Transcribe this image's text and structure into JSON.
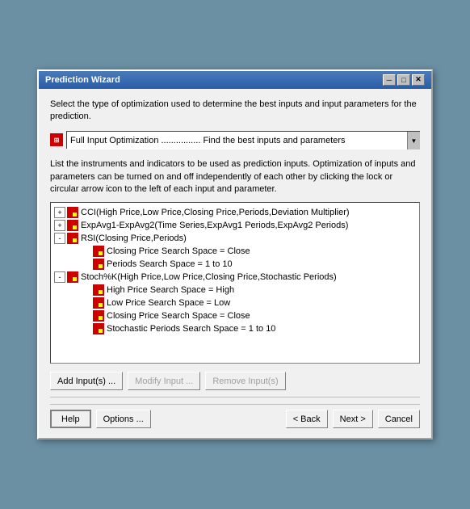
{
  "window": {
    "title": "Prediction Wizard",
    "close_btn": "✕",
    "minimize_btn": "─",
    "maximize_btn": "□"
  },
  "header": {
    "instruction1": "Select the type of optimization used to determine the best inputs and input parameters for the prediction.",
    "dropdown": {
      "icon": "⊞",
      "value": "Full Input Optimization ................ Find the best inputs and parameters"
    },
    "instruction2": "List the instruments and indicators to be used as prediction inputs.  Optimization of inputs and parameters can be turned on and off independently of each other by clicking the lock or circular arrow icon to the left of each input and parameter."
  },
  "tree": {
    "items": [
      {
        "indent": 0,
        "expand": "+",
        "icon": true,
        "text": "CCI(High Price,Low Price,Closing Price,Periods,Deviation Multiplier)",
        "depth": 0
      },
      {
        "indent": 0,
        "expand": "+",
        "icon": true,
        "text": "ExpAvg1-ExpAvg2(Time Series,ExpAvg1 Periods,ExpAvg2 Periods)",
        "depth": 0
      },
      {
        "indent": 0,
        "expand": "-",
        "icon": true,
        "text": "RSI(Closing Price,Periods)",
        "depth": 0
      },
      {
        "indent": 1,
        "expand": null,
        "icon": true,
        "text": "Closing Price Search Space = Close",
        "depth": 1
      },
      {
        "indent": 1,
        "expand": null,
        "icon": true,
        "text": "Periods Search Space = 1 to 10",
        "depth": 1
      },
      {
        "indent": 0,
        "expand": "-",
        "icon": true,
        "text": "Stoch%K(High Price,Low Price,Closing Price,Stochastic Periods)",
        "depth": 0
      },
      {
        "indent": 1,
        "expand": null,
        "icon": true,
        "text": "High Price Search Space = High",
        "depth": 1
      },
      {
        "indent": 1,
        "expand": null,
        "icon": true,
        "text": "Low Price Search Space = Low",
        "depth": 1
      },
      {
        "indent": 1,
        "expand": null,
        "icon": true,
        "text": "Closing Price Search Space = Close",
        "depth": 1
      },
      {
        "indent": 1,
        "expand": null,
        "icon": true,
        "text": "Stochastic Periods Search Space = 1 to 10",
        "depth": 1
      }
    ]
  },
  "action_buttons": {
    "add": "Add Input(s) ...",
    "modify": "Modify Input ...",
    "remove": "Remove Input(s)"
  },
  "nav_buttons": {
    "help": "Help",
    "options": "Options ...",
    "back": "< Back",
    "next": "Next >",
    "cancel": "Cancel"
  }
}
